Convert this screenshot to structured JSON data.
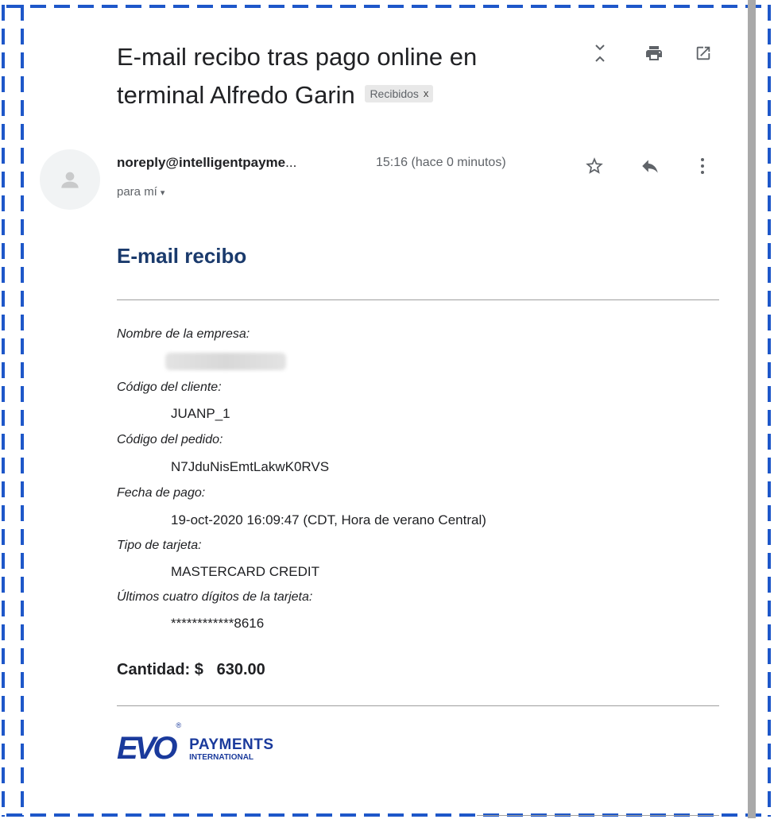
{
  "email": {
    "subject": "E-mail recibo tras pago online en terminal Alfredo Garin",
    "label": "Recibidos",
    "label_close": "x",
    "sender": "noreply@intelligentpayme",
    "sender_ellipsis": "...",
    "time": "15:16 (hace 0 minutos)",
    "to": "para mí",
    "to_caret": "▾"
  },
  "receipt": {
    "title": "E-mail recibo",
    "fields": [
      {
        "label": "Nombre de la empresa:",
        "value": ""
      },
      {
        "label": "Código del cliente:",
        "value": "JUANP_1"
      },
      {
        "label": "Código del pedido:",
        "value": "N7JduNisEmtLakwK0RVS"
      },
      {
        "label": "Fecha de pago:",
        "value": "19-oct-2020 16:09:47 (CDT, Hora de verano Central)"
      },
      {
        "label": "Tipo de tarjeta:",
        "value": "MASTERCARD CREDIT"
      },
      {
        "label": "Últimos cuatro dígitos de la tarjeta:",
        "value": "************8616"
      }
    ],
    "amount_label": "Cantidad: $",
    "amount_value": "630.00"
  },
  "logo": {
    "mark": "EVO",
    "line1": "PAYMENTS",
    "line2": "INTERNATIONAL",
    "registered": "®"
  },
  "icons": {
    "collapse": "collapse-icon",
    "print": "print-icon",
    "open_new": "open-in-new-window-icon",
    "star": "star-icon",
    "reply": "reply-icon",
    "more": "more-vertical-icon",
    "avatar": "person-icon"
  },
  "colors": {
    "frame": "#1e57c9",
    "title": "#1a3a6c",
    "logo": "#1a3a9c"
  }
}
